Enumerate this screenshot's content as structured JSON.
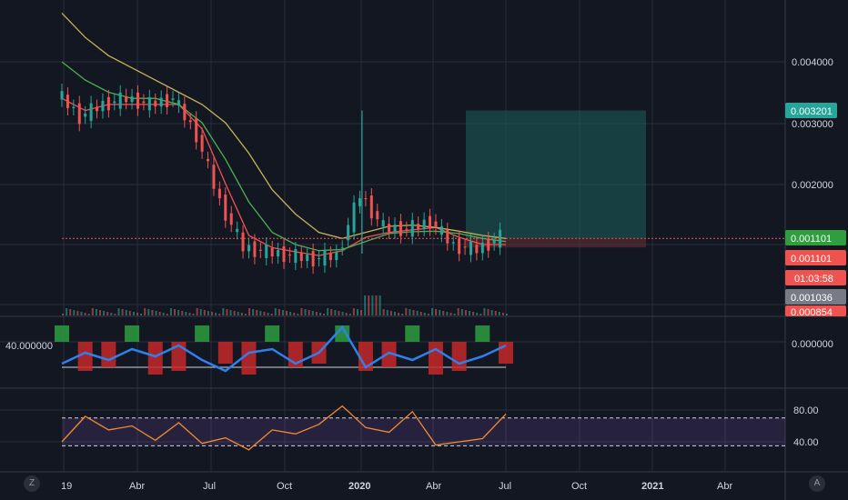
{
  "colors": {
    "background": "#131722",
    "grid": "#2a2e39",
    "separator": "#363a45",
    "candle_up": "#26a69a",
    "candle_down": "#ef5350",
    "ma_fast": "#ef5350",
    "ma_mid": "#4caf50",
    "ma_slow": "#c5b358",
    "osc_line": "#2f80ed",
    "rsi_line": "#f28a32",
    "rsi_band": "#7e57c2",
    "profit_zone": "#1b5e5a",
    "loss_zone": "#5c2b33"
  },
  "price_axis_labels": [
    "0.004000",
    "0.003000",
    "0.002000"
  ],
  "badges": [
    {
      "text": "0.003201",
      "color": "#26a69a"
    },
    {
      "text": "0.001101",
      "color": "#2e9e3e"
    },
    {
      "text": "0.001101",
      "color": "#ef5350"
    },
    {
      "text": "01:03:58",
      "color": "#ef5350"
    },
    {
      "text": "0.001036",
      "color": "#787b86"
    },
    {
      "text": "0.000854",
      "color": "#ef5350"
    }
  ],
  "osc_left_label": "40.000000",
  "osc_axis_label": "0.000000",
  "rsi_axis_labels": [
    "80.00",
    "40.00"
  ],
  "time_axis_labels": [
    "19",
    "Abr",
    "Jul",
    "Oct",
    "2020",
    "Abr",
    "Jul",
    "Oct",
    "2021",
    "Abr"
  ],
  "corner_buttons": {
    "left": "Z",
    "right": "A"
  },
  "chart_data": [
    {
      "type": "line",
      "panel": "price",
      "x": [
        "2019-01",
        "2019-02",
        "2019-03",
        "2019-04",
        "2019-05",
        "2019-06",
        "2019-07",
        "2019-08",
        "2019-09",
        "2019-10",
        "2019-11",
        "2019-12",
        "2020-01",
        "2020-01-15",
        "2020-02",
        "2020-03",
        "2020-04",
        "2020-05",
        "2020-06",
        "2020-07"
      ],
      "series": [
        {
          "role": "price",
          "values": [
            0.0035,
            0.0031,
            0.0033,
            0.0034,
            0.0033,
            0.0034,
            0.0028,
            0.0017,
            0.00095,
            0.00088,
            0.00082,
            0.00076,
            0.00082,
            0.00182,
            0.00128,
            0.00125,
            0.00138,
            0.00098,
            0.00092,
            0.00112
          ]
        },
        {
          "role": "ma_fast",
          "values": [
            0.0034,
            0.0032,
            0.0033,
            0.0033,
            0.0033,
            0.0033,
            0.0029,
            0.002,
            0.00115,
            0.00095,
            0.00088,
            0.00082,
            0.0009,
            0.00112,
            0.0012,
            0.00124,
            0.00128,
            0.00112,
            0.001,
            0.001
          ]
        },
        {
          "role": "ma_mid",
          "values": [
            0.004,
            0.0037,
            0.0035,
            0.0034,
            0.0034,
            0.0033,
            0.003,
            0.0024,
            0.0017,
            0.0012,
            0.001,
            0.0009,
            0.00092,
            0.00105,
            0.00118,
            0.00121,
            0.00122,
            0.00118,
            0.0011,
            0.00105
          ]
        },
        {
          "role": "ma_slow",
          "values": [
            0.0048,
            0.0044,
            0.0041,
            0.0039,
            0.0037,
            0.0035,
            0.0033,
            0.003,
            0.0025,
            0.0019,
            0.0015,
            0.0012,
            0.0011,
            0.0012,
            0.0013,
            0.00132,
            0.00128,
            0.00122,
            0.00115,
            0.0011
          ]
        }
      ],
      "ylim": [
        0.00085,
        0.0046
      ],
      "position_tool": {
        "entry": 0.001101,
        "target": 0.003201,
        "stop": 0.000953
      }
    },
    {
      "type": "line",
      "panel": "oscillator",
      "values": [
        -0.6,
        -0.3,
        -0.5,
        -0.2,
        -0.4,
        -0.1,
        -0.5,
        -0.8,
        -0.3,
        -0.2,
        -0.6,
        -0.3,
        0.4,
        -0.7,
        -0.3,
        -0.5,
        -0.2,
        -0.6,
        -0.4,
        -0.1
      ]
    },
    {
      "type": "line",
      "panel": "rsi",
      "values": [
        40,
        72,
        55,
        60,
        42,
        64,
        38,
        45,
        30,
        55,
        50,
        62,
        85,
        58,
        52,
        78,
        36,
        40,
        44,
        75
      ],
      "band": [
        35,
        70
      ],
      "ylim": [
        20,
        95
      ]
    }
  ]
}
